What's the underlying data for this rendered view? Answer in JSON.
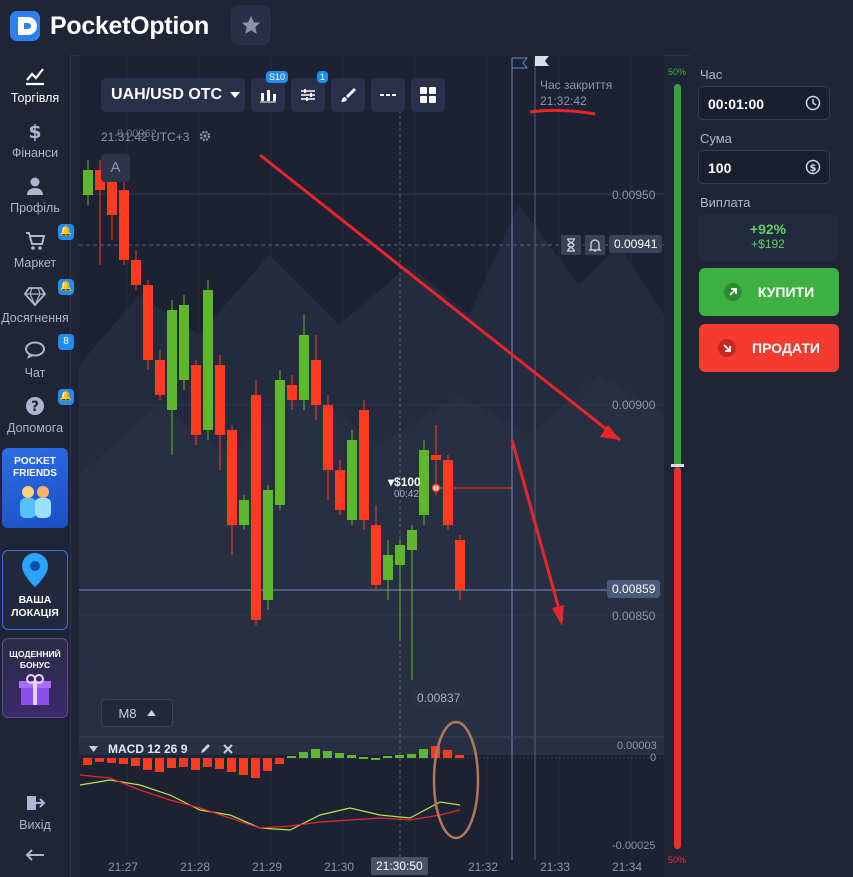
{
  "brand": {
    "name": "PocketOption"
  },
  "sidebar": {
    "items": [
      {
        "label": "Торгівля",
        "icon": "chart-line-icon"
      },
      {
        "label": "Фінанси",
        "icon": "dollar-icon"
      },
      {
        "label": "Профіль",
        "icon": "user-icon"
      },
      {
        "label": "Маркет",
        "icon": "cart-icon"
      },
      {
        "label": "Досягнення",
        "icon": "diamond-icon"
      },
      {
        "label": "Чат",
        "icon": "chat-icon",
        "badge": "8"
      },
      {
        "label": "Допомога",
        "icon": "help-icon"
      }
    ],
    "promos": [
      {
        "label": "POCKET FRIENDS"
      },
      {
        "label": "ВАША ЛОКАЦІЯ"
      },
      {
        "label": "ЩОДЕННИЙ БОНУС"
      }
    ],
    "exit_label": "Вихід"
  },
  "toolbar": {
    "pair": "UAH/USD OTC",
    "timeframe_badge": "S10",
    "indicators_badge": "1"
  },
  "chart": {
    "time_info": "21:31:42 UTC+3",
    "ghost_price": "0.00962",
    "tool_label": "A",
    "close_time_label": "Час закриття",
    "close_time_value": "21:32:42",
    "price_labels": [
      "0.00950",
      "0.00900",
      "0.00850"
    ],
    "alert_price": "0.00941",
    "current_price": "0.00859",
    "low_price": "0.00837",
    "trade_amount": "▾$100",
    "trade_timer": "00:42",
    "timeframe": "M8",
    "macd_label": "MACD 12 26 9",
    "macd_scale": [
      "0.00003",
      "0",
      "-0.00025"
    ],
    "time_axis": [
      "21:27",
      "21:28",
      "21:29",
      "21:30",
      "21:30:50",
      "21:32",
      "21:33",
      "21:34"
    ],
    "percent_top": "50%",
    "percent_bottom": "50%"
  },
  "trade_panel": {
    "time_label": "Час",
    "time_value": "00:01:00",
    "amount_label": "Сума",
    "amount_value": "100",
    "payout_label": "Виплата",
    "payout_percent": "+92%",
    "payout_amount": "+$192",
    "buy_label": "КУПИТИ",
    "sell_label": "ПРОДАТИ"
  },
  "colors": {
    "up": "#5fb82c",
    "down": "#ff3b1f",
    "buy": "#3fb042",
    "sell": "#f53b2f",
    "accent": "#1f8ef1",
    "annotation": "#e8262a"
  }
}
